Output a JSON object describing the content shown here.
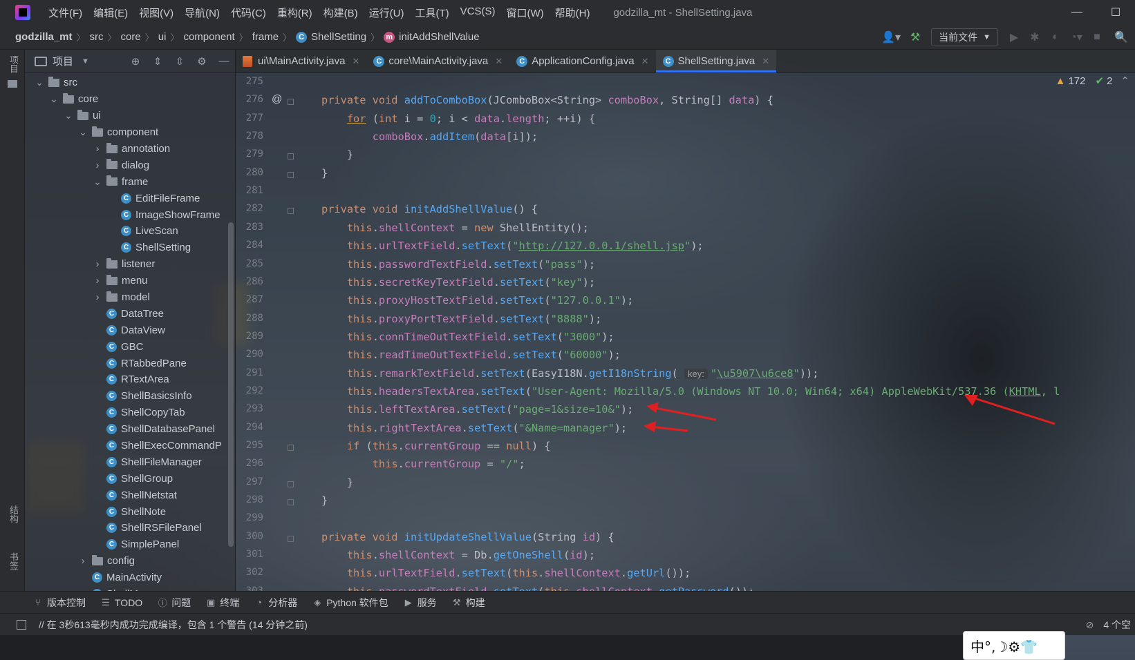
{
  "window": {
    "title": "godzilla_mt - ShellSetting.java",
    "menu": [
      "文件(F)",
      "编辑(E)",
      "视图(V)",
      "导航(N)",
      "代码(C)",
      "重构(R)",
      "构建(B)",
      "运行(U)",
      "工具(T)",
      "VCS(S)",
      "窗口(W)",
      "帮助(H)"
    ]
  },
  "breadcrumb": {
    "project": "godzilla_mt",
    "parts": [
      "src",
      "core",
      "ui",
      "component",
      "frame"
    ],
    "class": "ShellSetting",
    "method": "initAddShellValue"
  },
  "toolbar": {
    "run_config": "当前文件"
  },
  "stripe": {
    "project": "项目",
    "structure": "结构",
    "bookmarks": "书签"
  },
  "project_panel": {
    "title": "项目",
    "tree": [
      {
        "label": "src",
        "type": "folder",
        "depth": 1,
        "expanded": true
      },
      {
        "label": "core",
        "type": "folder",
        "depth": 2,
        "expanded": true
      },
      {
        "label": "ui",
        "type": "folder",
        "depth": 3,
        "expanded": true
      },
      {
        "label": "component",
        "type": "folder",
        "depth": 4,
        "expanded": true
      },
      {
        "label": "annotation",
        "type": "folder",
        "depth": 5,
        "expanded": false
      },
      {
        "label": "dialog",
        "type": "folder",
        "depth": 5,
        "expanded": false
      },
      {
        "label": "frame",
        "type": "folder",
        "depth": 5,
        "expanded": true
      },
      {
        "label": "EditFileFrame",
        "type": "class",
        "depth": 6
      },
      {
        "label": "ImageShowFrame",
        "type": "class",
        "depth": 6
      },
      {
        "label": "LiveScan",
        "type": "class",
        "depth": 6
      },
      {
        "label": "ShellSetting",
        "type": "class",
        "depth": 6
      },
      {
        "label": "listener",
        "type": "folder",
        "depth": 5,
        "expanded": false
      },
      {
        "label": "menu",
        "type": "folder",
        "depth": 5,
        "expanded": false
      },
      {
        "label": "model",
        "type": "folder",
        "depth": 5,
        "expanded": false
      },
      {
        "label": "DataTree",
        "type": "class",
        "depth": 5
      },
      {
        "label": "DataView",
        "type": "class",
        "depth": 5
      },
      {
        "label": "GBC",
        "type": "class",
        "depth": 5
      },
      {
        "label": "RTabbedPane",
        "type": "class",
        "depth": 5
      },
      {
        "label": "RTextArea",
        "type": "class",
        "depth": 5
      },
      {
        "label": "ShellBasicsInfo",
        "type": "class",
        "depth": 5
      },
      {
        "label": "ShellCopyTab",
        "type": "class",
        "depth": 5
      },
      {
        "label": "ShellDatabasePanel",
        "type": "class",
        "depth": 5
      },
      {
        "label": "ShellExecCommandP",
        "type": "class",
        "depth": 5
      },
      {
        "label": "ShellFileManager",
        "type": "class",
        "depth": 5
      },
      {
        "label": "ShellGroup",
        "type": "class",
        "depth": 5
      },
      {
        "label": "ShellNetstat",
        "type": "class",
        "depth": 5
      },
      {
        "label": "ShellNote",
        "type": "class",
        "depth": 5
      },
      {
        "label": "ShellRSFilePanel",
        "type": "class",
        "depth": 5
      },
      {
        "label": "SimplePanel",
        "type": "class",
        "depth": 5
      },
      {
        "label": "config",
        "type": "folder",
        "depth": 4,
        "expanded": false
      },
      {
        "label": "MainActivity",
        "type": "class",
        "depth": 4
      },
      {
        "label": "ShellManage",
        "type": "class",
        "depth": 4
      }
    ]
  },
  "tabs": [
    {
      "label": "ui\\MainActivity.java",
      "icon": "java-file-icon",
      "active": false
    },
    {
      "label": "core\\MainActivity.java",
      "icon": "class-icon",
      "active": false
    },
    {
      "label": "ApplicationConfig.java",
      "icon": "class-icon",
      "active": false
    },
    {
      "label": "ShellSetting.java",
      "icon": "class-icon",
      "active": true
    }
  ],
  "inspections": {
    "warnings": "172",
    "ok": "2"
  },
  "editor": {
    "lines": [
      {
        "n": "275",
        "html": ""
      },
      {
        "n": "276",
        "mark": "@",
        "html": "<span class='kw'>private void </span><span class='fn'>addToComboBox</span>(JComboBox&lt;String&gt; <span class='fld'>comboBox</span>, String[] <span class='fld'>data</span>) {"
      },
      {
        "n": "277",
        "html": "    <span class='kw ul'>for</span> (<span class='kw'>int </span>i = <span class='num'>0</span>; i &lt; <span class='fld'>data</span>.<span class='fld'>length</span>; ++i) {"
      },
      {
        "n": "278",
        "html": "        <span class='fld'>comboBox</span>.<span class='fn'>addItem</span>(<span class='fld'>data</span>[i]);"
      },
      {
        "n": "279",
        "html": "    }"
      },
      {
        "n": "280",
        "html": "}"
      },
      {
        "n": "281",
        "html": ""
      },
      {
        "n": "282",
        "html": "<span class='kw'>private void </span><span class='fn'>initAddShellValue</span>() {"
      },
      {
        "n": "283",
        "html": "    <span class='kw'>this</span>.<span class='fld'>shellContext</span> = <span class='kw'>new </span>ShellEntity();"
      },
      {
        "n": "284",
        "html": "    <span class='kw'>this</span>.<span class='fld'>urlTextField</span>.<span class='fn'>setText</span>(<span class='str'>\"</span><span class='lnk'>http://127.0.0.1/shell.jsp</span><span class='str'>\"</span>);"
      },
      {
        "n": "285",
        "html": "    <span class='kw'>this</span>.<span class='fld'>passwordTextField</span>.<span class='fn'>setText</span>(<span class='str'>\"pass\"</span>);"
      },
      {
        "n": "286",
        "html": "    <span class='kw'>this</span>.<span class='fld'>secretKeyTextField</span>.<span class='fn'>setText</span>(<span class='str'>\"key\"</span>);"
      },
      {
        "n": "287",
        "html": "    <span class='kw'>this</span>.<span class='fld'>proxyHostTextField</span>.<span class='fn'>setText</span>(<span class='str'>\"127.0.0.1\"</span>);"
      },
      {
        "n": "288",
        "html": "    <span class='kw'>this</span>.<span class='fld'>proxyPortTextField</span>.<span class='fn'>setText</span>(<span class='str'>\"8888\"</span>);"
      },
      {
        "n": "289",
        "html": "    <span class='kw'>this</span>.<span class='fld'>connTimeOutTextField</span>.<span class='fn'>setText</span>(<span class='str'>\"3000\"</span>);"
      },
      {
        "n": "290",
        "html": "    <span class='kw'>this</span>.<span class='fld'>readTimeOutTextField</span>.<span class='fn'>setText</span>(<span class='str'>\"60000\"</span>);"
      },
      {
        "n": "291",
        "html": "    <span class='kw'>this</span>.<span class='fld'>remarkTextField</span>.<span class='fn'>setText</span>(EasyI18N.<span class='fn'>getI18nString</span>( <span class='hint'>key:</span><span class='str'>\"</span><span class='lnk'>\\u5907\\u6ce8</span><span class='str'>\"</span>));"
      },
      {
        "n": "292",
        "html": "    <span class='kw'>this</span>.<span class='fld'>headersTextArea</span>.<span class='fn'>setText</span>(<span class='str'>\"User-Agent: Mozilla/5.0 (Windows NT 10.0; Win64; x64) AppleWebKit/537.36 (<span class='ul'>KHTML</span>, l</span>"
      },
      {
        "n": "293",
        "html": "    <span class='kw'>this</span>.<span class='fld'>leftTextArea</span>.<span class='fn'>setText</span>(<span class='str'>\"page=1&amp;size=10&amp;\"</span>);"
      },
      {
        "n": "294",
        "html": "    <span class='kw'>this</span>.<span class='fld'>rightTextArea</span>.<span class='fn'>setText</span>(<span class='str'>\"&amp;Name=manager\"</span>);"
      },
      {
        "n": "295",
        "html": "    <span class='kw'>if </span>(<span class='kw'>this</span>.<span class='fld'>currentGroup</span> == <span class='kw'>null</span>) {"
      },
      {
        "n": "296",
        "html": "        <span class='kw'>this</span>.<span class='fld'>currentGroup</span> = <span class='str'>\"/\"</span>;"
      },
      {
        "n": "297",
        "html": "    }"
      },
      {
        "n": "298",
        "html": "}"
      },
      {
        "n": "299",
        "html": ""
      },
      {
        "n": "300",
        "html": "<span class='kw'>private void </span><span class='fn'>initUpdateShellValue</span>(String <span class='fld'>id</span>) {"
      },
      {
        "n": "301",
        "html": "    <span class='kw'>this</span>.<span class='fld'>shellContext</span> = Db.<span class='fn'>getOneShell</span>(<span class='fld'>id</span>);"
      },
      {
        "n": "302",
        "html": "    <span class='kw'>this</span>.<span class='fld'>urlTextField</span>.<span class='fn'>setText</span>(<span class='kw'>this</span>.<span class='fld'>shellContext</span>.<span class='fn'>getUrl</span>());"
      },
      {
        "n": "303",
        "html": "    <span class='kw'>this</span>.<span class='fld'>passwordTextField</span>.<span class='fn'>setText</span>(<span class='kw'>this</span>.<span class='fld'>shellContext</span>.<span class='fn'>getPassword</span>());"
      }
    ]
  },
  "toolwindows": [
    {
      "label": "版本控制",
      "icon": "vcs-icon"
    },
    {
      "label": "TODO",
      "icon": "todo-icon"
    },
    {
      "label": "问题",
      "icon": "problems-icon"
    },
    {
      "label": "终端",
      "icon": "terminal-icon"
    },
    {
      "label": "分析器",
      "icon": "profiler-icon"
    },
    {
      "label": "Python 软件包",
      "icon": "packages-icon"
    },
    {
      "label": "服务",
      "icon": "services-icon"
    },
    {
      "label": "构建",
      "icon": "build-icon"
    }
  ],
  "status": {
    "message": "// 在 3秒613毫秒内成功完成编译，包含 1 个警告 (14 分钟之前)",
    "indent": "4 个空",
    "ime": "中°,☽⚙👕"
  },
  "colors": {
    "accent": "#3574f0",
    "annotation_arrow": "#e02020"
  }
}
